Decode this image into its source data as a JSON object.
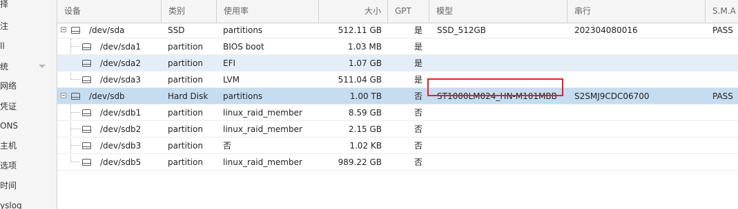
{
  "sidebar": {
    "items": [
      "择",
      "注",
      "ll",
      "统",
      "网络",
      "凭证",
      "ONS",
      "主机",
      "选项",
      "时间",
      "yslog"
    ]
  },
  "columns": {
    "device": "设备",
    "type": "类别",
    "usage": "使用率",
    "size": "大小",
    "gpt": "GPT",
    "model": "模型",
    "serial": "串行",
    "smart": "S.M.A"
  },
  "rows": [
    {
      "device": "/dev/sda",
      "type": "SSD",
      "usage": "partitions",
      "size": "512.11 GB",
      "gpt": "是",
      "model": "SSD_512GB",
      "serial": "202304080016",
      "smart": "PASS"
    },
    {
      "device": "/dev/sda1",
      "type": "partition",
      "usage": "BIOS boot",
      "size": "1.03 MB",
      "gpt": "是",
      "model": "",
      "serial": "",
      "smart": ""
    },
    {
      "device": "/dev/sda2",
      "type": "partition",
      "usage": "EFI",
      "size": "1.07 GB",
      "gpt": "是",
      "model": "",
      "serial": "",
      "smart": ""
    },
    {
      "device": "/dev/sda3",
      "type": "partition",
      "usage": "LVM",
      "size": "511.04 GB",
      "gpt": "是",
      "model": "",
      "serial": "",
      "smart": ""
    },
    {
      "device": "/dev/sdb",
      "type": "Hard Disk",
      "usage": "partitions",
      "size": "1.00 TB",
      "gpt": "否",
      "model": "ST1000LM024_HN-M101MBB",
      "serial": "S2SMJ9CDC06700",
      "smart": "PASS"
    },
    {
      "device": "/dev/sdb1",
      "type": "partition",
      "usage": "linux_raid_member",
      "size": "8.59 GB",
      "gpt": "否",
      "model": "",
      "serial": "",
      "smart": ""
    },
    {
      "device": "/dev/sdb2",
      "type": "partition",
      "usage": "linux_raid_member",
      "size": "2.15 GB",
      "gpt": "否",
      "model": "",
      "serial": "",
      "smart": ""
    },
    {
      "device": "/dev/sdb3",
      "type": "partition",
      "usage": "否",
      "size": "1.02 KB",
      "gpt": "否",
      "model": "",
      "serial": "",
      "smart": ""
    },
    {
      "device": "/dev/sdb5",
      "type": "partition",
      "usage": "linux_raid_member",
      "size": "989.22 GB",
      "gpt": "否",
      "model": "",
      "serial": "",
      "smart": ""
    }
  ]
}
